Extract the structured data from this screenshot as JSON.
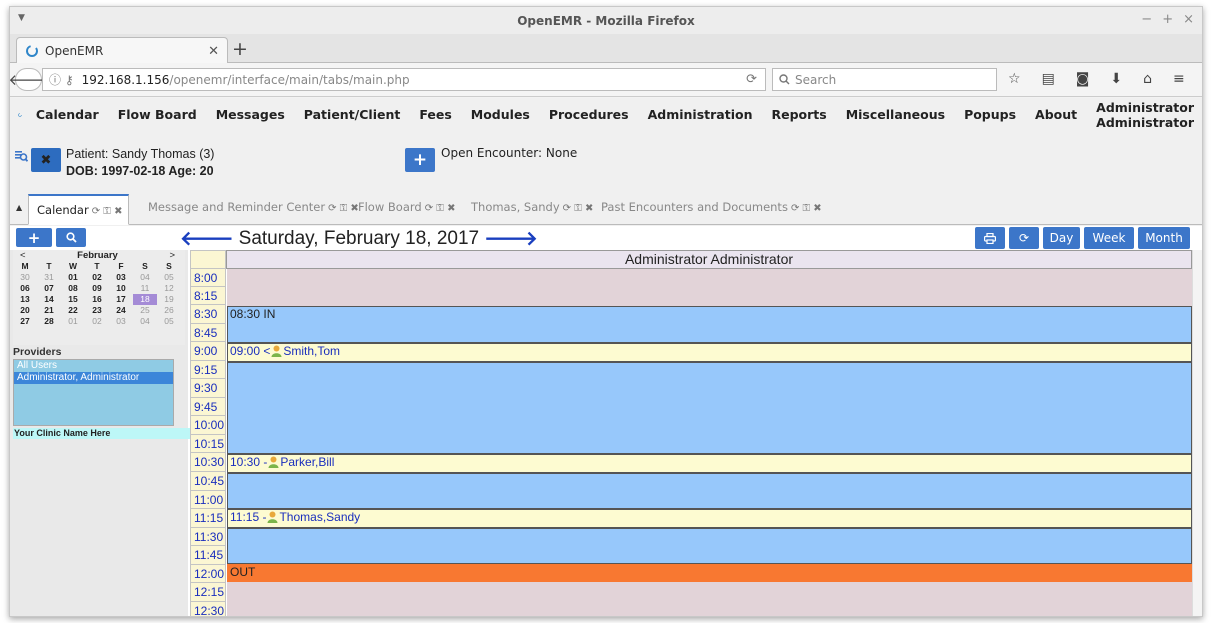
{
  "window": {
    "title": "OpenEMR - Mozilla Firefox"
  },
  "browser": {
    "tab_title": "OpenEMR",
    "url_host": "192.168.1.156",
    "url_path": "/openemr/interface/main/tabs/main.php",
    "search_placeholder": "Search"
  },
  "menu": {
    "items": [
      "Calendar",
      "Flow Board",
      "Messages",
      "Patient/Client",
      "Fees",
      "Modules",
      "Procedures",
      "Administration",
      "Reports",
      "Miscellaneous",
      "Popups",
      "About"
    ],
    "user": "Administrator Administrator"
  },
  "patient": {
    "label": "Patient:",
    "name": "Sandy Thomas (3)",
    "dob_line": "DOB: 1997-02-18 Age: 20",
    "encounter_label": "Open Encounter:",
    "encounter_value": "None"
  },
  "app_tabs": [
    "Calendar",
    "Message and Reminder Center",
    "Flow Board",
    "Thomas, Sandy",
    "Past Encounters and Documents"
  ],
  "calendar": {
    "date_title": "Saturday, February 18, 2017",
    "view_buttons": [
      "Day",
      "Week",
      "Month"
    ],
    "provider_header": "Administrator Administrator",
    "mini": {
      "month": "February",
      "prev": "<",
      "next": ">",
      "weekdays": [
        "M",
        "T",
        "W",
        "T",
        "F",
        "S",
        "S"
      ],
      "weeks": [
        [
          "30",
          "31",
          "01",
          "02",
          "03",
          "04",
          "05"
        ],
        [
          "06",
          "07",
          "08",
          "09",
          "10",
          "11",
          "12"
        ],
        [
          "13",
          "14",
          "15",
          "16",
          "17",
          "18",
          "19"
        ],
        [
          "20",
          "21",
          "22",
          "23",
          "24",
          "25",
          "26"
        ],
        [
          "27",
          "28",
          "01",
          "02",
          "03",
          "04",
          "05"
        ]
      ],
      "selected": "18"
    },
    "providers_label": "Providers",
    "providers": [
      "All Users",
      "Administrator, Administrator"
    ],
    "clinic_name": "Your Clinic Name Here",
    "times": [
      "8:00",
      "8:15",
      "8:30",
      "8:45",
      "9:00",
      "9:15",
      "9:30",
      "9:45",
      "10:00",
      "10:15",
      "10:30",
      "10:45",
      "11:00",
      "11:15",
      "11:30",
      "11:45",
      "12:00",
      "12:15",
      "12:30"
    ],
    "events": {
      "in": "08:30 IN",
      "smith_time": "09:00 <",
      "smith_name": "Smith,Tom",
      "parker_time": "10:30 -",
      "parker_name": "Parker,Bill",
      "thomas_time": "11:15 -",
      "thomas_name": "Thomas,Sandy",
      "out": "OUT"
    }
  },
  "colors": {
    "accent": "#3c76c9",
    "event_blue": "#97c8fb",
    "event_yellow": "#fdfbd1",
    "out_orange": "#f87831",
    "day_bg": "#e2d3d8"
  }
}
